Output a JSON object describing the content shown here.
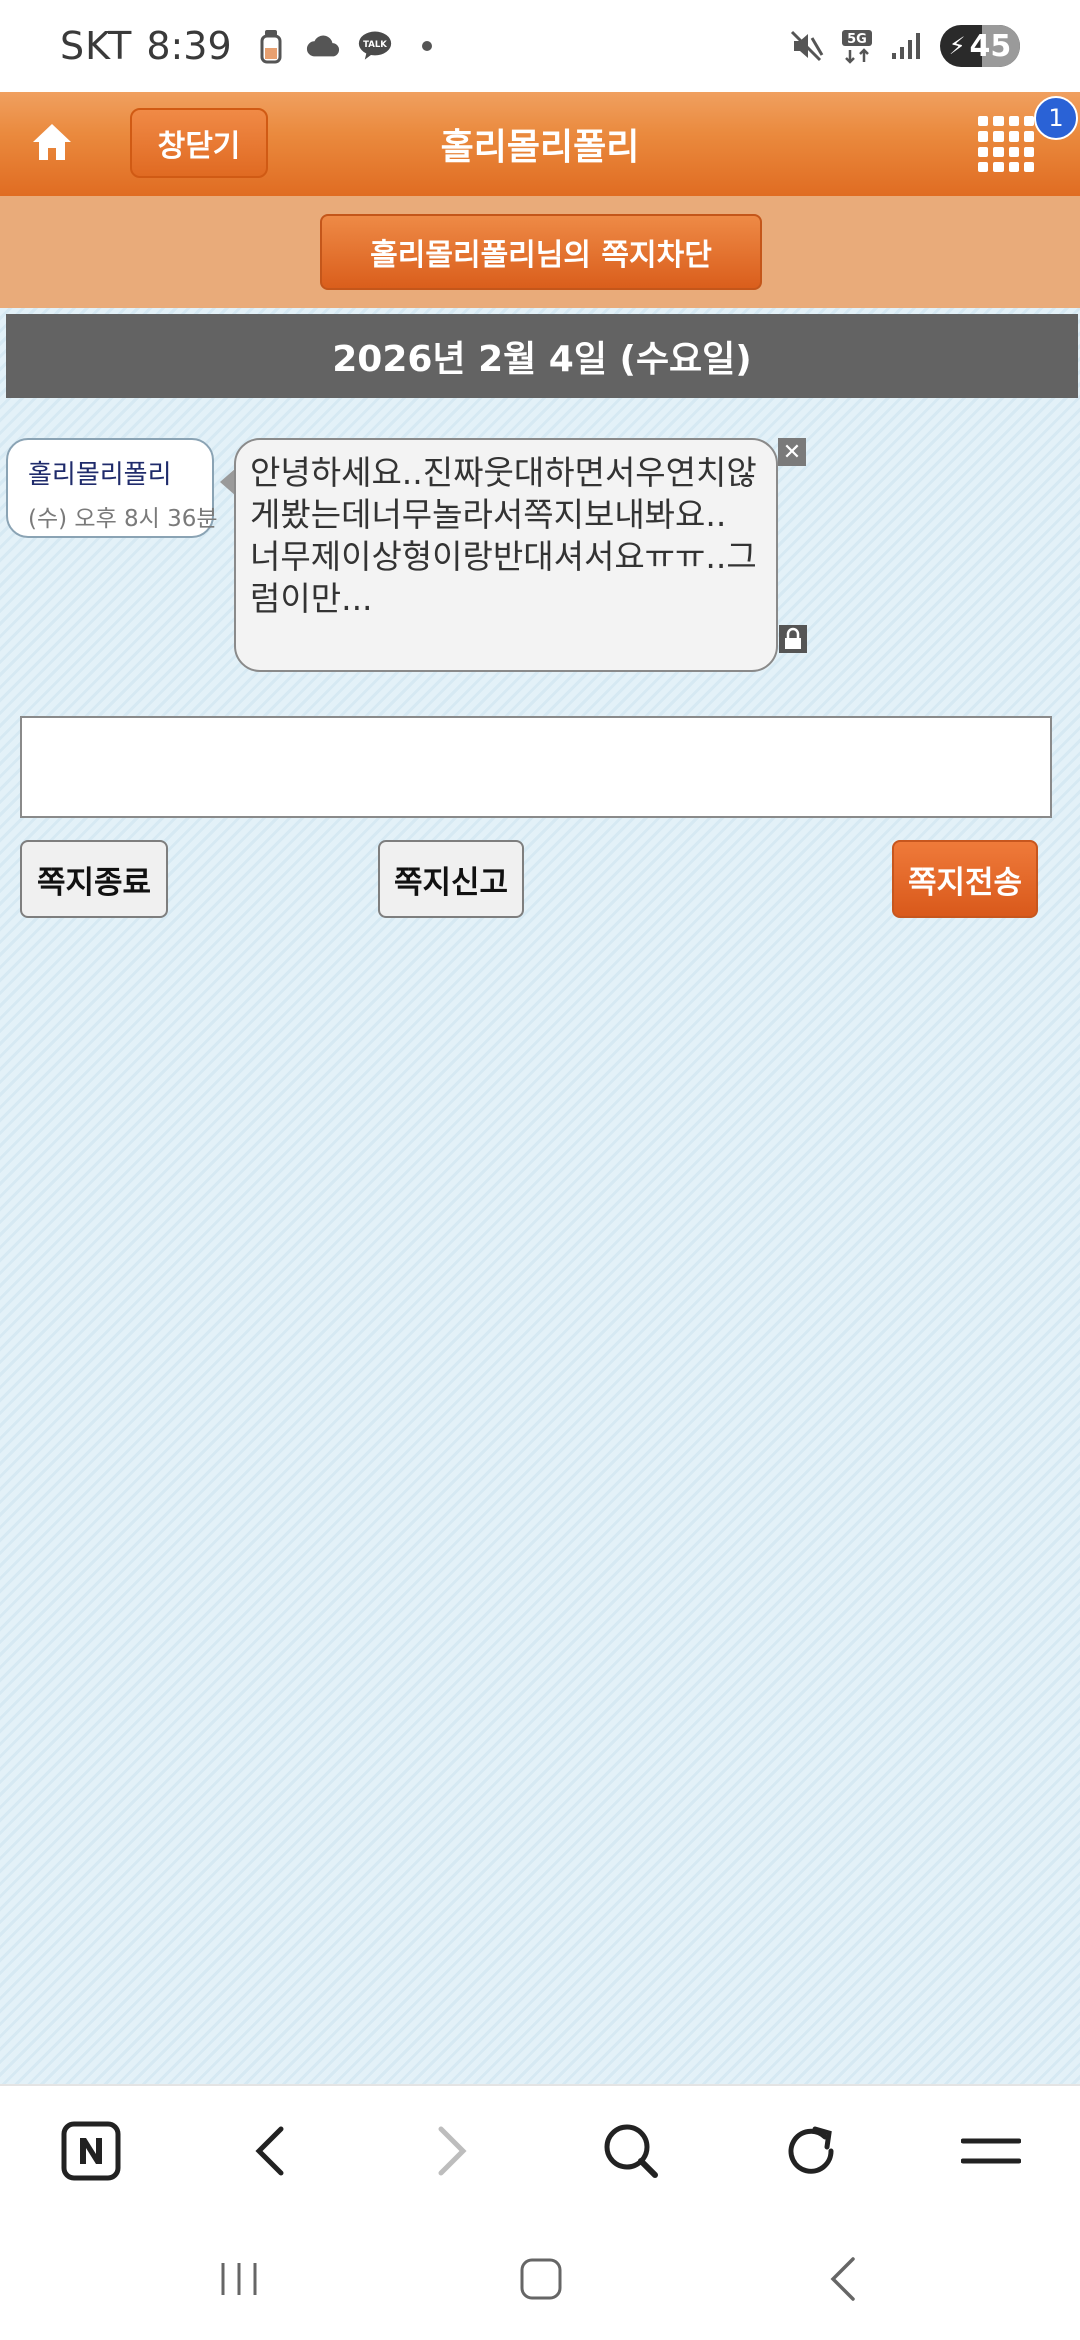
{
  "status_bar": {
    "carrier": "SKT",
    "time": "8:39",
    "talk_label": "TALK",
    "network": "5G",
    "battery": "45"
  },
  "header": {
    "close_label": "창닫기",
    "title": "홀리몰리폴리",
    "notification_count": "1"
  },
  "block_button_label": "홀리몰리폴리님의 쪽지차단",
  "date_bar": "2026년 2월 4일 (수요일)",
  "message": {
    "sender_name": "홀리몰리폴리",
    "sent_time": "(수) 오후 8시 36분",
    "text": "안녕하세요..진짜웃대하면서우연치않게봤는데너무놀라서쪽지보내봐요..\n너무제이상형이랑반대셔서요ㅠㅠ..그럼이만..."
  },
  "reply_input": {
    "value": "",
    "placeholder": ""
  },
  "actions": {
    "end_label": "쪽지종료",
    "report_label": "쪽지신고",
    "send_label": "쪽지전송"
  },
  "colors": {
    "accent": "#e06c22",
    "date_bar": "#636363",
    "badge": "#2a62d6"
  },
  "icons": {
    "status_left": [
      "baby-bottle-icon",
      "cloud-icon",
      "kakaotalk-icon",
      "dot-icon"
    ],
    "status_right": [
      "mute-icon",
      "5g-icon",
      "signal-icon",
      "battery-icon"
    ],
    "browser": [
      "naver-icon",
      "back-icon",
      "forward-icon",
      "search-icon",
      "refresh-icon",
      "menu-icon"
    ],
    "system_nav": [
      "recents-icon",
      "home-icon",
      "back-icon"
    ]
  }
}
